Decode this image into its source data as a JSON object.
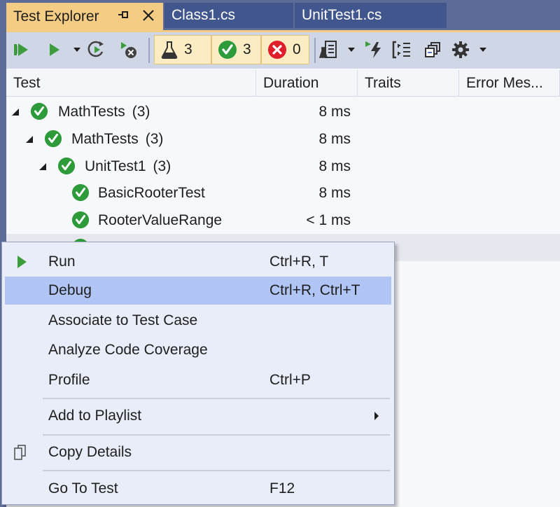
{
  "tabs": [
    {
      "label": "Test Explorer",
      "active": true,
      "pin_icon": "pin-icon",
      "close_icon": "close-icon"
    },
    {
      "label": "Class1.cs",
      "active": false
    },
    {
      "label": "UnitTest1.cs",
      "active": false
    }
  ],
  "toolbar": {
    "buttons": [
      {
        "name": "run-all-tests",
        "icon": "run-all-icon"
      },
      {
        "name": "run-tests",
        "icon": "play-icon"
      },
      {
        "name": "run-dropdown",
        "icon": "chevron-down-icon"
      },
      {
        "name": "repeat-last-run",
        "icon": "repeat-run-icon"
      },
      {
        "name": "cancel-run",
        "icon": "cancel-run-icon"
      }
    ],
    "counters": {
      "total": "3",
      "passed": "3",
      "failed": "0"
    },
    "right_buttons": [
      {
        "name": "playlist",
        "icon": "playlist-icon"
      },
      {
        "name": "live-unit-testing",
        "icon": "run-lightning-icon"
      },
      {
        "name": "group-by",
        "icon": "group-by-icon"
      },
      {
        "name": "open-test-window",
        "icon": "windows-icon"
      },
      {
        "name": "settings",
        "icon": "gear-icon"
      }
    ]
  },
  "grid": {
    "columns": [
      "Test",
      "Duration",
      "Traits",
      "Error Mes..."
    ],
    "rows": [
      {
        "name": "MathTests",
        "count": "(3)",
        "duration": "8 ms",
        "level": 0,
        "expandable": true,
        "status": "passed"
      },
      {
        "name": "MathTests",
        "count": "(3)",
        "duration": "8 ms",
        "level": 1,
        "expandable": true,
        "status": "passed"
      },
      {
        "name": "UnitTest1",
        "count": "(3)",
        "duration": "8 ms",
        "level": 2,
        "expandable": true,
        "status": "passed"
      },
      {
        "name": "BasicRooterTest",
        "count": "",
        "duration": "8 ms",
        "level": 3,
        "expandable": false,
        "status": "passed"
      },
      {
        "name": "RooterValueRange",
        "count": "",
        "duration": "< 1 ms",
        "level": 3,
        "expandable": false,
        "status": "passed"
      }
    ]
  },
  "context_menu": {
    "items": [
      {
        "label": "Run",
        "shortcut": "Ctrl+R, T",
        "icon": "play-icon",
        "highlighted": false
      },
      {
        "label": "Debug",
        "shortcut": "Ctrl+R, Ctrl+T",
        "highlighted": true
      },
      {
        "label": "Associate to Test Case",
        "shortcut": ""
      },
      {
        "label": "Analyze Code Coverage",
        "shortcut": ""
      },
      {
        "label": "Profile",
        "shortcut": "Ctrl+P"
      },
      {
        "label": "Add to Playlist",
        "shortcut": "",
        "submenu": true
      },
      {
        "label": "Copy Details",
        "shortcut": "",
        "icon": "copy-icon"
      },
      {
        "label": "Go To Test",
        "shortcut": "F12"
      }
    ]
  },
  "colors": {
    "active_tab": "#f5cc84",
    "inactive_tab": "#40568d",
    "frame": "#5d6b99",
    "toolbar": "#cfd6e5",
    "pass_green": "#2d9b3a",
    "fail_red": "#e01d2b",
    "menu_bg": "#e8edf9",
    "menu_highlight": "#b1c5f5"
  }
}
